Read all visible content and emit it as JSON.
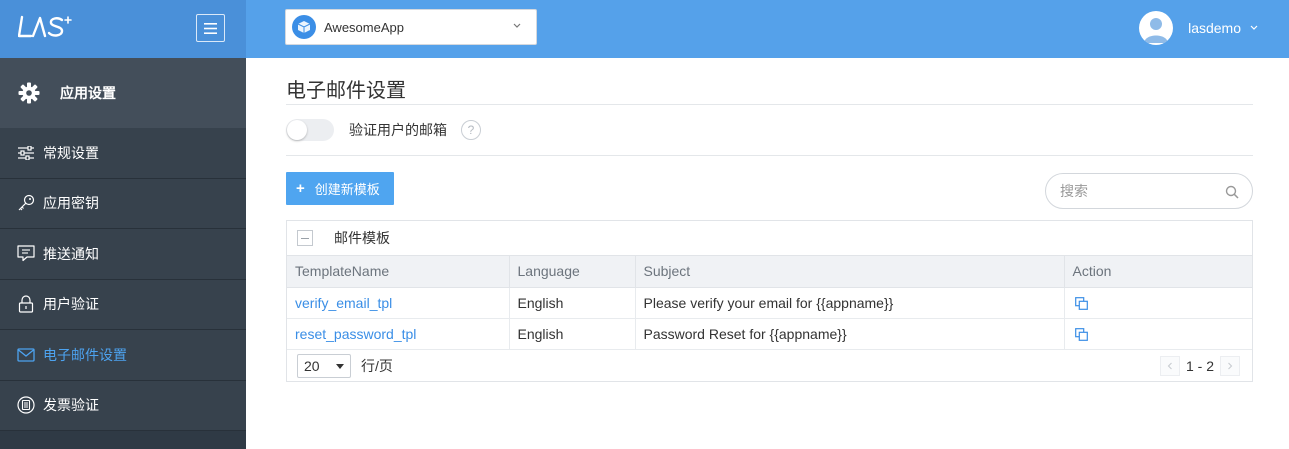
{
  "header": {
    "logo_text": "LAS",
    "app_selector": {
      "selected": "AwesomeApp"
    },
    "user": {
      "name": "lasdemo"
    }
  },
  "sidebar": {
    "section": {
      "label": "应用设置",
      "icon": "gear-icon"
    },
    "items": [
      {
        "label": "常规设置",
        "icon": "sliders-icon",
        "active": false
      },
      {
        "label": "应用密钥",
        "icon": "key-icon",
        "active": false
      },
      {
        "label": "推送通知",
        "icon": "message-icon",
        "active": false
      },
      {
        "label": "用户验证",
        "icon": "lock-icon",
        "active": false
      },
      {
        "label": "电子邮件设置",
        "icon": "mail-icon",
        "active": true
      },
      {
        "label": "发票验证",
        "icon": "receipt-icon",
        "active": false
      }
    ]
  },
  "main": {
    "title": "电子邮件设置",
    "verify_toggle": {
      "label": "验证用户的邮箱",
      "enabled": false,
      "help": "?"
    },
    "create_button": "创建新模板",
    "search": {
      "placeholder": "搜索"
    },
    "table": {
      "caption": "邮件模板",
      "columns": [
        "TemplateName",
        "Language",
        "Subject",
        "Action"
      ],
      "rows": [
        {
          "name": "verify_email_tpl",
          "language": "English",
          "subject": "Please verify your email for {{appname}}",
          "action_icon": "copy-icon"
        },
        {
          "name": "reset_password_tpl",
          "language": "English",
          "subject": "Password Reset for {{appname}}",
          "action_icon": "copy-icon"
        }
      ],
      "page_size": "20",
      "per_page_label": "行/页",
      "range": "1 - 2"
    }
  },
  "colors": {
    "topbar": "#55a1ea",
    "logo_bg": "#4a90d9",
    "sidebar_bg": "#2f3a45",
    "accent": "#4fa5f0",
    "link": "#3a8ee6"
  }
}
